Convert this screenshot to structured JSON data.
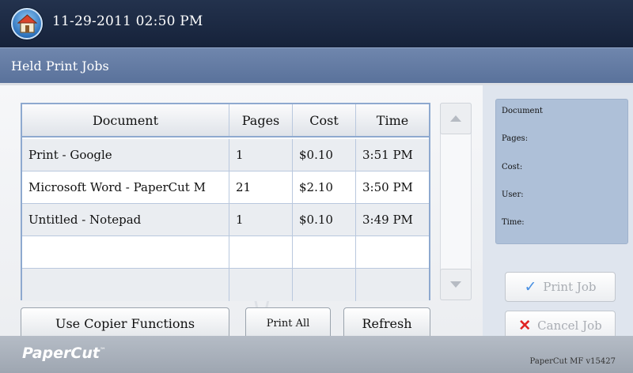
{
  "header": {
    "datetime": "11-29-2011 02:50 PM",
    "home_icon": "home-icon"
  },
  "page": {
    "title": "Held Print Jobs"
  },
  "table": {
    "columns": [
      "Document",
      "Pages",
      "Cost",
      "Time"
    ],
    "rows": [
      {
        "document": "Print - Google",
        "pages": "1",
        "cost": "$0.10",
        "time": "3:51 PM"
      },
      {
        "document": "Microsoft Word - PaperCut M",
        "pages": "21",
        "cost": "$2.10",
        "time": "3:50 PM"
      },
      {
        "document": "Untitled - Notepad",
        "pages": "1",
        "cost": "$0.10",
        "time": "3:49 PM"
      },
      {
        "document": "",
        "pages": "",
        "cost": "",
        "time": ""
      },
      {
        "document": "",
        "pages": "",
        "cost": "",
        "time": ""
      }
    ]
  },
  "actions": {
    "use_copier": "Use Copier Functions",
    "print_all": "Print All",
    "refresh": "Refresh"
  },
  "details": {
    "document_label": "Document",
    "pages_label": "Pages:",
    "cost_label": "Cost:",
    "user_label": "User:",
    "time_label": "Time:"
  },
  "job_actions": {
    "print_job": "Print Job",
    "cancel_job": "Cancel Job"
  },
  "footer": {
    "logo": "PaperCut",
    "version": "PaperCut MF v15427"
  },
  "colors": {
    "header_bg": "#1c2a44",
    "title_bg": "#647ca5",
    "table_border": "#8ea9cf",
    "details_bg": "#aec0d8",
    "check": "#4a90e2",
    "cross": "#e02424"
  }
}
